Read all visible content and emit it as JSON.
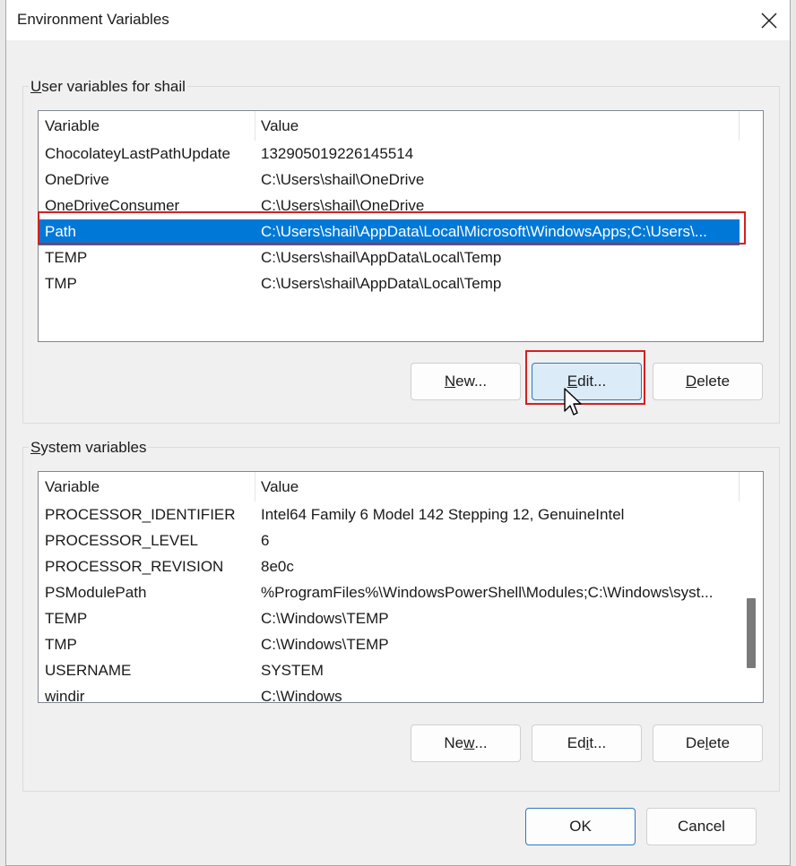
{
  "window": {
    "title": "Environment Variables"
  },
  "user_group": {
    "label_accel": "U",
    "label_rest": "ser variables for shail",
    "columns": [
      "Variable",
      "Value"
    ],
    "rows": [
      {
        "variable": "ChocolateyLastPathUpdate",
        "value": "132905019226145514"
      },
      {
        "variable": "OneDrive",
        "value": "C:\\Users\\shail\\OneDrive"
      },
      {
        "variable": "OneDriveConsumer",
        "value": "C:\\Users\\shail\\OneDrive"
      },
      {
        "variable": "Path",
        "value": "C:\\Users\\shail\\AppData\\Local\\Microsoft\\WindowsApps;C:\\Users\\...",
        "selected": true
      },
      {
        "variable": "TEMP",
        "value": "C:\\Users\\shail\\AppData\\Local\\Temp"
      },
      {
        "variable": "TMP",
        "value": "C:\\Users\\shail\\AppData\\Local\\Temp"
      }
    ],
    "buttons": {
      "new_accel": "N",
      "new_rest": "ew...",
      "edit_accel": "E",
      "edit_rest": "dit...",
      "delete_accel": "D",
      "delete_rest": "elete"
    }
  },
  "system_group": {
    "label_accel": "S",
    "label_rest": "ystem variables",
    "columns": [
      "Variable",
      "Value"
    ],
    "rows": [
      {
        "variable": "PROCESSOR_IDENTIFIER",
        "value": "Intel64 Family 6 Model 142 Stepping 12, GenuineIntel"
      },
      {
        "variable": "PROCESSOR_LEVEL",
        "value": "6"
      },
      {
        "variable": "PROCESSOR_REVISION",
        "value": "8e0c"
      },
      {
        "variable": "PSModulePath",
        "value": "%ProgramFiles%\\WindowsPowerShell\\Modules;C:\\Windows\\syst..."
      },
      {
        "variable": "TEMP",
        "value": "C:\\Windows\\TEMP"
      },
      {
        "variable": "TMP",
        "value": "C:\\Windows\\TEMP"
      },
      {
        "variable": "USERNAME",
        "value": "SYSTEM"
      },
      {
        "variable": "windir",
        "value": "C:\\Windows"
      }
    ],
    "buttons": {
      "new_pre": "Ne",
      "new_accel": "w",
      "new_rest": "...",
      "edit_pre": "Ed",
      "edit_accel": "i",
      "edit_rest": "t...",
      "delete_pre": "De",
      "delete_accel": "l",
      "delete_rest": "ete"
    }
  },
  "footer": {
    "ok": "OK",
    "cancel": "Cancel"
  },
  "colors": {
    "selection": "#0078d7",
    "annotation": "#d32020",
    "button_hover": "#dcebf8"
  },
  "icons": {
    "close": "close-icon",
    "cursor": "mouse-pointer-icon"
  }
}
